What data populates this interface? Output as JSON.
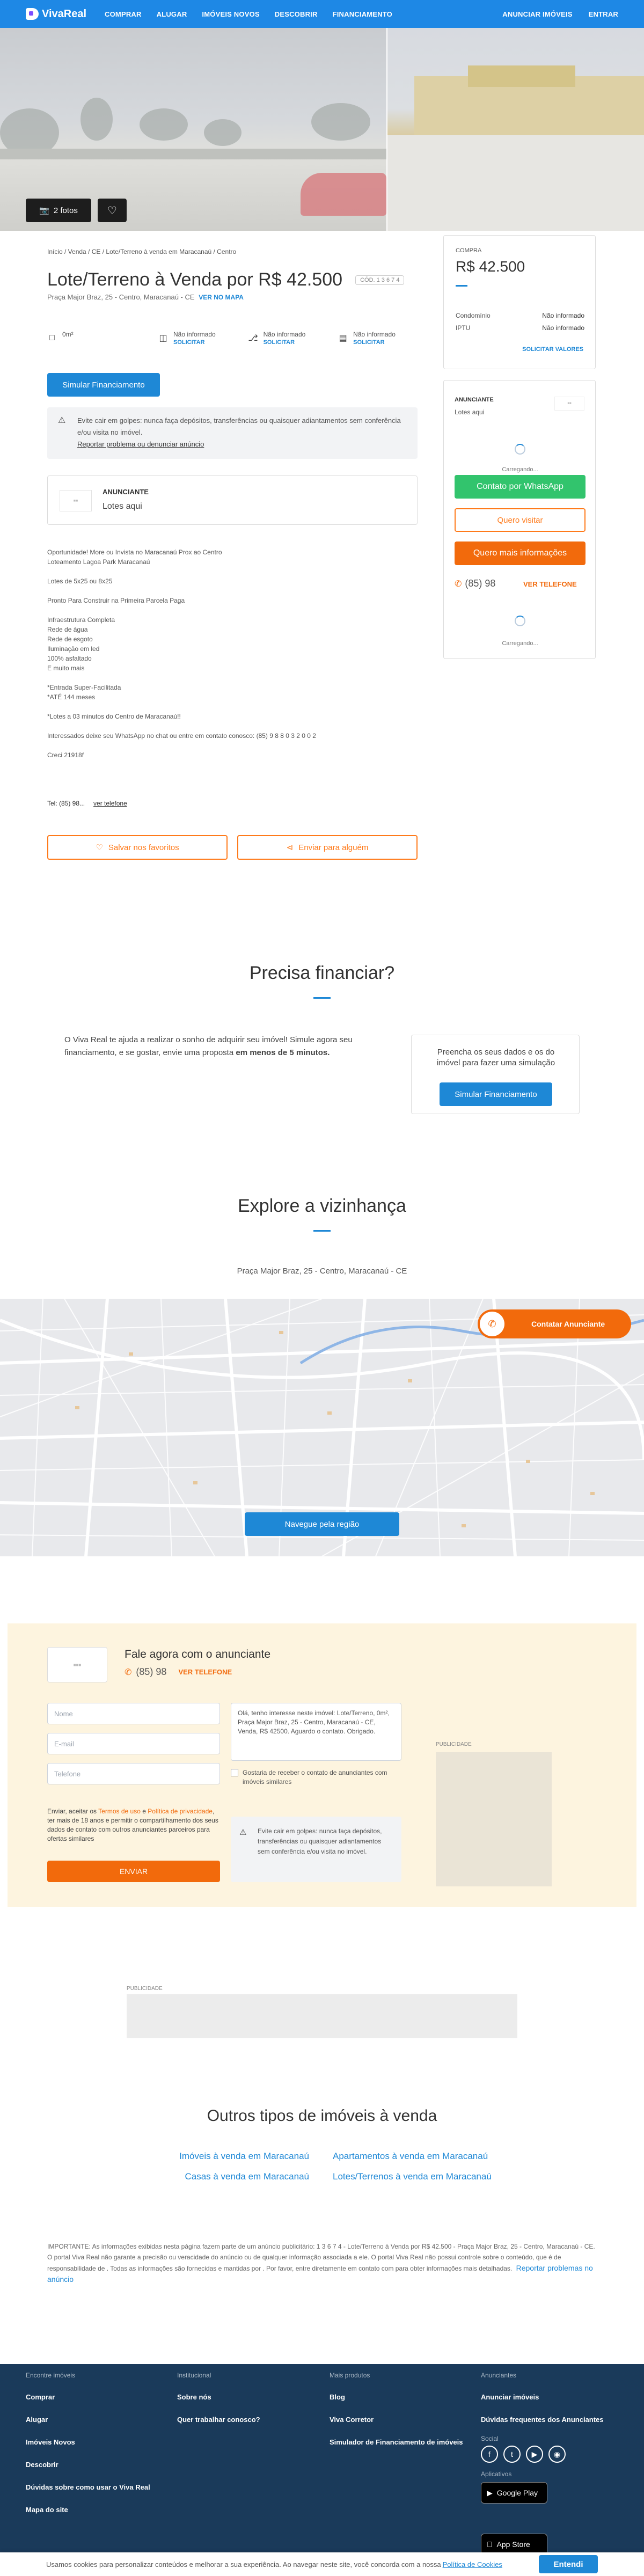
{
  "nav": {
    "logo": "VivaReal",
    "items": [
      "COMPRAR",
      "ALUGAR",
      "IMÓVEIS NOVOS",
      "DESCOBRIR",
      "FINANCIAMENTO"
    ],
    "right": [
      "ANUNCIAR IMÓVEIS",
      "ENTRAR"
    ]
  },
  "hero": {
    "photos_label": "2 fotos"
  },
  "listing": {
    "breadcrumb": "Início / Venda / CE / Lote/Terreno à venda em Maracanaú / Centro",
    "title": "Lote/Terreno à Venda por R$ 42.500",
    "code": "CÓD. 1 3 6 7 4",
    "address": "Praça Major Braz, 25 - Centro, Maracanaú - CE",
    "see_map": "VER NO MAPA",
    "features": [
      {
        "icon": "area-icon",
        "value": "0m²",
        "action": ""
      },
      {
        "icon": "bed-icon",
        "value": "Não informado",
        "action": "SOLICITAR"
      },
      {
        "icon": "shower-icon",
        "value": "Não informado",
        "action": "SOLICITAR"
      },
      {
        "icon": "car-icon",
        "value": "Não informado",
        "action": "SOLICITAR"
      }
    ],
    "simulate_btn": "Simular Financiamento",
    "warning": "Evite cair em golpes: nunca faça depósitos, transferências ou quaisquer adiantamentos sem conferência e/ou visita no imóvel.",
    "report": "Reportar problema ou denunciar anúncio",
    "advertiser_label": "ANUNCIANTE",
    "advertiser_name": "Lotes aqui",
    "description": "Oportunidade! More ou Invista no Maracanaú Prox ao Centro\nLoteamento Lagoa Park Maracanaú\n\nLotes de 5x25 ou 8x25\n\nPronto Para Construir na Primeira Parcela Paga\n\nInfraestrutura Completa\nRede de água\nRede de esgoto\nIluminação em led\n100% asfaltado\nE muito mais\n\n*Entrada Super-Facilitada\n*ATÉ 144 meses\n\n*Lotes a 03 minutos do Centro de Maracanaú!!\n\nInteressados deixe seu WhatsApp no chat ou entre em contato conosco: (85) 9 8 8 0 3 2 0 0 2\n\nCreci 21918f",
    "phone_label": "Tel: (85) 98...",
    "see_phone": "ver telefone",
    "fav_btn": "Salvar nos favoritos",
    "share_btn": "Enviar para alguém"
  },
  "sidebar": {
    "type": "COMPRA",
    "price": "R$ 42.500",
    "condo_label": "Condomínio",
    "condo_value": "Não informado",
    "iptu_label": "IPTU",
    "iptu_value": "Não informado",
    "request_values": "SOLICITAR VALORES",
    "advertiser_label": "ANUNCIANTE",
    "advertiser_name": "Lotes aqui",
    "loading": "Carregando...",
    "whatsapp_btn": "Contato por WhatsApp",
    "visit_btn": "Quero visitar",
    "info_btn": "Quero mais informações",
    "phone": "(85) 98",
    "see_phone": "VER TELEFONE",
    "loading2": "Carregando..."
  },
  "financing": {
    "title": "Precisa financiar?",
    "text_a": "O Viva Real te ajuda a realizar o sonho de adquirir seu imóvel! Simule agora seu financiamento, e se gostar, envie uma proposta ",
    "text_b": "em menos de 5 minutos.",
    "box_text": "Preencha os seus dados e os do imóvel para fazer uma simulação",
    "box_btn": "Simular Financiamento"
  },
  "neighborhood": {
    "title": "Explore a vizinhança",
    "address": "Praça Major Braz, 25 - Centro, Maracanaú - CE",
    "contact_btn": "Contatar Anunciante",
    "map_btn": "Navegue pela região"
  },
  "contact": {
    "title": "Fale agora com o anunciante",
    "phone": "(85) 98",
    "see_phone": "VER TELEFONE",
    "name_ph": "Nome",
    "email_ph": "E-mail",
    "phone_ph": "Telefone",
    "message": "Olá, tenho interesse neste imóvel: Lote/Terreno, 0m², Praça Major Braz, 25 - Centro, Maracanaú - CE, Venda, R$ 42500. Aguardo o contato. Obrigado.",
    "checkbox": "Gostaria de receber o contato de anunciantes com imóveis similares",
    "terms_a": "Enviar, aceitar os ",
    "terms_link1": "Termos de uso",
    "terms_b": " e ",
    "terms_link2": "Política de privacidade",
    "terms_c": ", ter mais de 18 anos e permitir o compartilhamento dos seus dados de contato com outros anunciantes parceiros para ofertas similares",
    "send_btn": "ENVIAR",
    "warning": "Evite cair em golpes: nunca faça depósitos, transferências ou quaisquer adiantamentos sem conferência e/ou visita no imóvel.",
    "ad_label": "PUBLICIDADE"
  },
  "ad": {
    "label": "PUBLICIDADE"
  },
  "other_types": {
    "title": "Outros tipos de imóveis à venda",
    "links": [
      "Imóveis à venda em Maracanaú",
      "Apartamentos à venda em Maracanaú",
      "Casas à venda em Maracanaú",
      "Lotes/Terrenos à venda em Maracanaú"
    ]
  },
  "disclaimer": {
    "text": "IMPORTANTE: As informações exibidas nesta página fazem parte de um anúncio publicitário: 1 3 6 7 4 - Lote/Terreno à Venda por R$ 42.500 - Praça Major Braz, 25 - Centro, Maracanaú - CE. O portal Viva Real não garante a precisão ou veracidade do anúncio ou de qualquer informação associada a ele. O portal Viva Real não possui controle sobre o conteúdo, que é de responsabilidade de . Todas as informações são fornecidas e mantidas por . Por favor, entre diretamente em contato com para obter informações mais detalhadas.",
    "report": "Reportar problemas no anúncio"
  },
  "footer": {
    "cols": [
      {
        "title": "Encontre imóveis",
        "links": [
          "Comprar",
          "Alugar",
          "Imóveis Novos",
          "Descobrir",
          "Dúvidas sobre como usar o Viva Real",
          "Mapa do site"
        ]
      },
      {
        "title": "Institucional",
        "links": [
          "Sobre nós",
          "Quer trabalhar conosco?"
        ]
      },
      {
        "title": "Mais produtos",
        "links": [
          "Blog",
          "Viva Corretor",
          "Simulador de Financiamento de imóveis"
        ]
      },
      {
        "title": "Anunciantes",
        "links": [
          "Anunciar imóveis",
          "Dúvidas frequentes dos Anunciantes"
        ]
      }
    ],
    "social_label": "Social",
    "apps_label": "Aplicativos",
    "google_play": "Google Play",
    "app_store": "App Store"
  },
  "cookie": {
    "text": "Usamos cookies para personalizar conteúdos e melhorar a sua experiência. Ao navegar neste site, você concorda com a nossa ",
    "link": "Política de Cookies",
    "btn": "Entendi"
  }
}
